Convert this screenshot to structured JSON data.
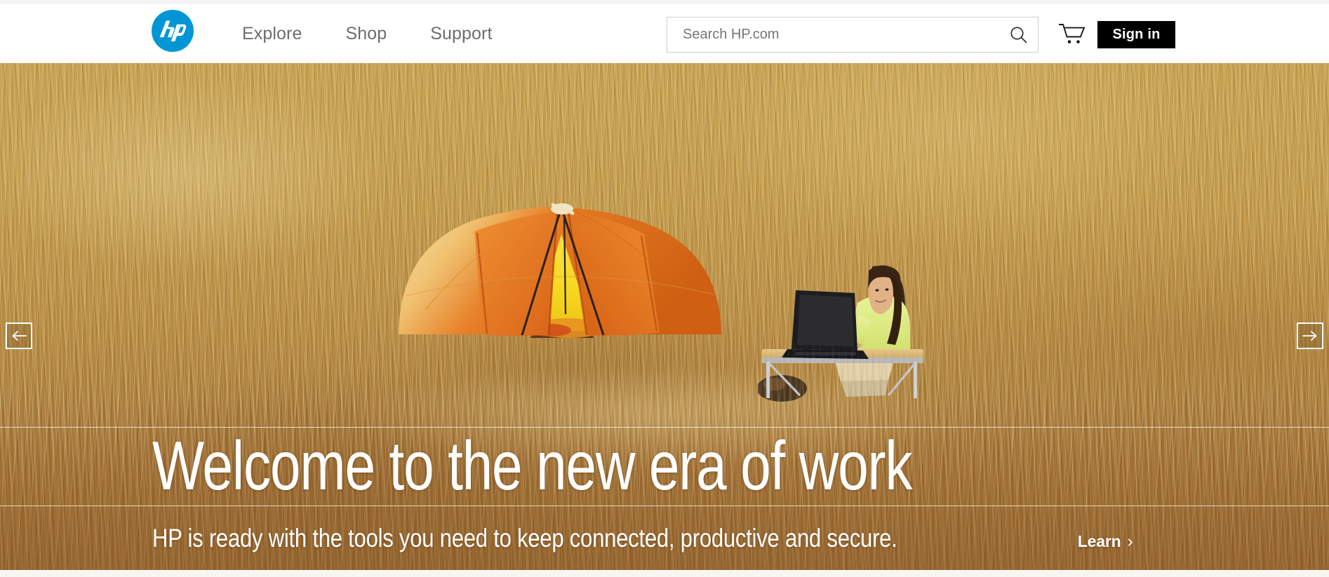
{
  "site": {
    "brand": "HP",
    "logo_alt": "HP logo",
    "brand_color": "#0096D6"
  },
  "header": {
    "nav": [
      {
        "label": "Explore",
        "name": "nav-explore"
      },
      {
        "label": "Shop",
        "name": "nav-shop"
      },
      {
        "label": "Support",
        "name": "nav-support"
      }
    ],
    "search": {
      "placeholder": "Search HP.com",
      "value": "",
      "icon": "search-icon"
    },
    "cart": {
      "icon": "shopping-cart-icon",
      "label": ""
    },
    "signin": {
      "label": "Sign in"
    }
  },
  "hero": {
    "headline": "Welcome to the new era of work",
    "subheadline": "HP is ready with the tools you need to keep connected, productive and secure.",
    "cta": {
      "label": "Learn",
      "chevron": "›"
    },
    "carousel": {
      "prev_icon": "arrow-left-icon",
      "prev_label": "Previous slide",
      "next_icon": "arrow-right-icon",
      "next_label": "Next slide"
    },
    "image_description": "Woman working on a laptop at a folding table beside an orange dome tent in tall golden grass",
    "colors": {
      "grass": "#c4a04f",
      "tent_orange": "#e2701f",
      "tent_interior": "#f5d426",
      "overlay_rule": "#ffffff"
    }
  }
}
